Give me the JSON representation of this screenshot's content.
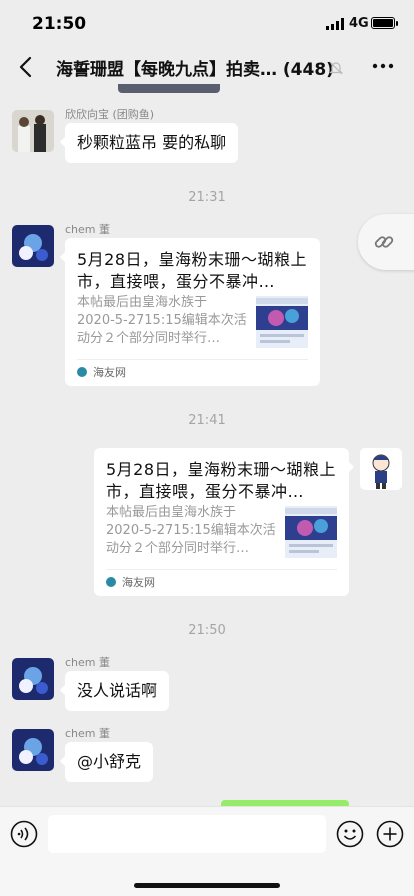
{
  "status": {
    "time": "21:50",
    "network": "4G"
  },
  "header": {
    "title": "海誓珊盟【每晚九点】拍卖… (448)"
  },
  "messages": [
    {
      "sender": "欣欣向宝 (团购鱼)",
      "text": "秒颗粒蓝吊 要的私聊"
    },
    {
      "timestamp": "21:31"
    },
    {
      "sender": "chem 董",
      "card": {
        "title": "5月28日，皇海粉末珊～瑚粮上市，直接喂，蛋分不暴冲…",
        "desc": "本帖最后由皇海水族于 2020-5-2715:15编辑本次活动分２个部分同时举行…",
        "source": "海友网"
      }
    },
    {
      "timestamp": "21:41"
    },
    {
      "self": true,
      "card": {
        "title": "5月28日，皇海粉末珊～瑚粮上市，直接喂，蛋分不暴冲…",
        "desc": "本帖最后由皇海水族于 2020-5-2715:15编辑本次活动分２个部分同时举行…",
        "source": "海友网"
      }
    },
    {
      "timestamp": "21:50"
    },
    {
      "sender": "chem 董",
      "text": "没人说话啊"
    },
    {
      "sender": "chem 董",
      "text": "@小舒克"
    }
  ],
  "input": {
    "value": ""
  },
  "colors": {
    "background": "#ededed",
    "bubble": "#ffffff",
    "self_bubble": "#95ec69"
  }
}
